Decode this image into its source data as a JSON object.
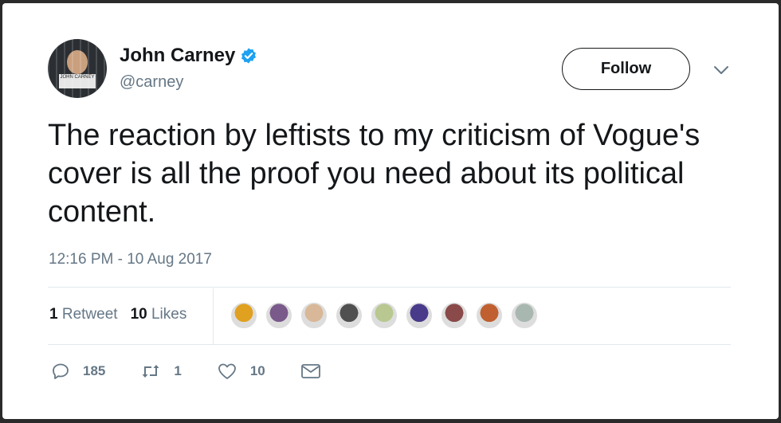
{
  "author": {
    "name": "John Carney",
    "handle": "@carney",
    "avatar_sign_text": "JOHN CARNEY"
  },
  "follow_label": "Follow",
  "tweet": {
    "text": "The reaction by leftists to my criticism of Vogue's cover is all the proof you need about its political content.",
    "timestamp": "12:16 PM - 10 Aug 2017"
  },
  "stats": {
    "retweets_count": "1",
    "retweets_label": "Retweet",
    "likes_count": "10",
    "likes_label": "Likes"
  },
  "likers": [
    {
      "color": "#e0a020"
    },
    {
      "color": "#7a5a8a"
    },
    {
      "color": "#d8b898"
    },
    {
      "color": "#505050"
    },
    {
      "color": "#b8c890"
    },
    {
      "color": "#4a3a8a"
    },
    {
      "color": "#8a4a4a"
    },
    {
      "color": "#c06030"
    },
    {
      "color": "#a8b8b0"
    }
  ],
  "actions": {
    "reply_count": "185",
    "retweet_count": "1",
    "like_count": "10"
  },
  "colors": {
    "verified": "#1da1f2",
    "secondary_text": "#657786"
  }
}
